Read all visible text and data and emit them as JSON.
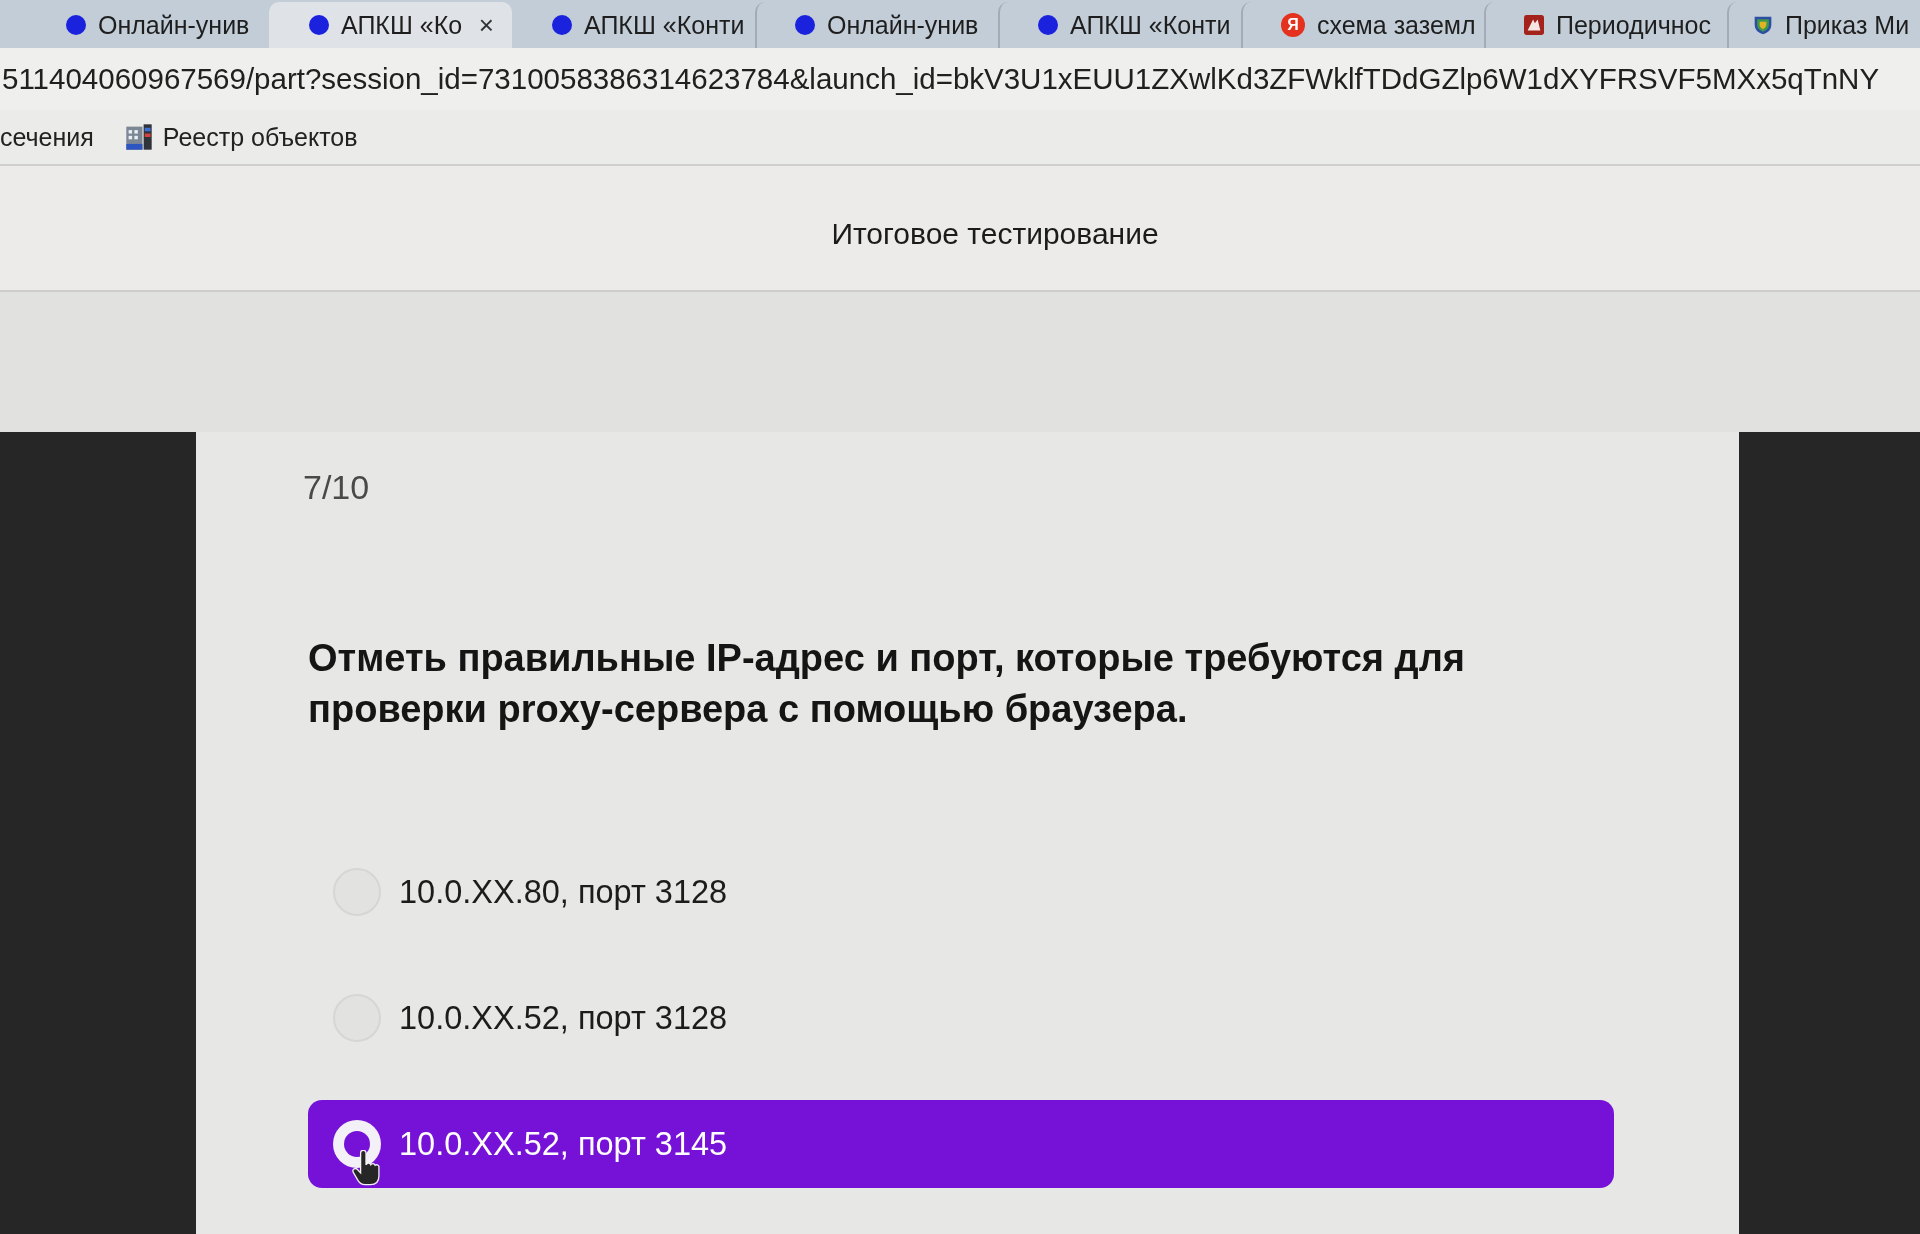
{
  "browser": {
    "tabs": [
      {
        "title": "Онлайн-унив",
        "favicon": {
          "kind": "dot"
        },
        "selected": false
      },
      {
        "title": "АПКШ «Ко",
        "favicon": {
          "kind": "dot"
        },
        "selected": true,
        "close": "×"
      },
      {
        "title": "АПКШ «Конти",
        "favicon": {
          "kind": "dot"
        },
        "selected": false
      },
      {
        "title": "Онлайн-унив",
        "favicon": {
          "kind": "dot"
        },
        "selected": false
      },
      {
        "title": "АПКШ «Конти",
        "favicon": {
          "kind": "dot"
        },
        "selected": false
      },
      {
        "title": "схема заземл",
        "favicon": {
          "kind": "letter",
          "glyph": "Я"
        },
        "selected": false
      },
      {
        "title": "Периодичнос",
        "favicon": {
          "kind": "tile"
        },
        "selected": false
      },
      {
        "title": "Приказ Ми",
        "favicon": {
          "kind": "shield"
        },
        "selected": false
      }
    ],
    "address_bar": {
      "url": "511404060967569/part?session_id=7310058386314623784&launch_id=bkV3U1xEUU1ZXwlKd3ZFWklfTDdGZlp6W1dXYFRSVF5MXx5qTnNY"
    },
    "bookmarks": [
      {
        "label": "сечения"
      },
      {
        "label": "Реестр объектов"
      }
    ]
  },
  "page": {
    "title": "Итоговое тестирование"
  },
  "quiz": {
    "progress": "7/10",
    "question": "Отметь правильные IP-адрес и порт, которые требуются для проверки proxy-сервера с помощью браузера.",
    "options": [
      {
        "label": "10.0.XX.80, порт 3128",
        "selected": false
      },
      {
        "label": "10.0.XX.52, порт 3128",
        "selected": false
      },
      {
        "label": "10.0.XX.52, порт 3145",
        "selected": true
      }
    ]
  }
}
